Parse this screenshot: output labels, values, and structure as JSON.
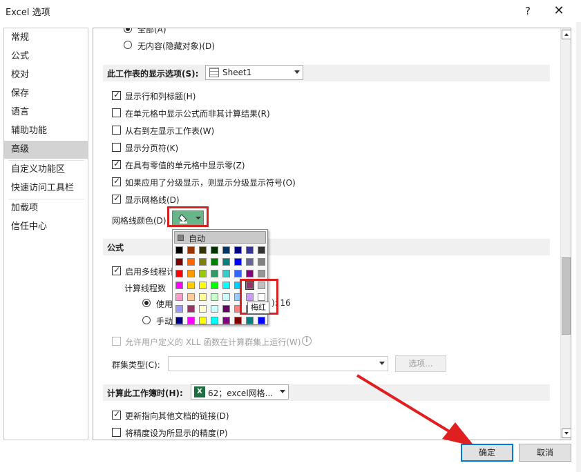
{
  "window": {
    "title": "Excel 选项",
    "help_label": "?",
    "close_label": "✕"
  },
  "sidebar": {
    "items": [
      {
        "label": "常规"
      },
      {
        "label": "公式"
      },
      {
        "label": "校对"
      },
      {
        "label": "保存"
      },
      {
        "label": "语言"
      },
      {
        "label": "辅助功能"
      },
      {
        "label": "高级",
        "active": true
      },
      {
        "label": "自定义功能区"
      },
      {
        "label": "快速访问工具栏"
      },
      {
        "label": "加载项"
      },
      {
        "label": "信任中心"
      }
    ]
  },
  "objects_display": {
    "all_label": "全部(A)",
    "nothing_label": "无内容(隐藏对象)(D)"
  },
  "worksheet_display": {
    "title": "此工作表的显示选项(S):",
    "sheet": "Sheet1",
    "options": [
      {
        "label": "显示行和列标题(H)",
        "checked": true
      },
      {
        "label": "在单元格中显示公式而非其计算结果(R)",
        "checked": false
      },
      {
        "label": "从右到左显示工作表(W)",
        "checked": false
      },
      {
        "label": "显示分页符(K)",
        "checked": false
      },
      {
        "label": "在具有零值的单元格中显示零(Z)",
        "checked": true
      },
      {
        "label": "如果应用了分级显示，则显示分级显示符号(O)",
        "checked": true
      },
      {
        "label": "显示网格线(D)",
        "checked": true
      }
    ],
    "gridline_color_label": "网格线颜色(D)",
    "gridline_color": "#68b58a"
  },
  "palette": {
    "auto_label": "自动",
    "tooltip": "梅红",
    "rows": [
      [
        "#000000",
        "#993300",
        "#333300",
        "#003300",
        "#003366",
        "#000080",
        "#333399",
        "#333333"
      ],
      [
        "#800000",
        "#ff6600",
        "#808000",
        "#008000",
        "#008080",
        "#0000ff",
        "#666699",
        "#808080"
      ],
      [
        "#ff0000",
        "#ff9900",
        "#99cc00",
        "#339966",
        "#33cccc",
        "#3366ff",
        "#800080",
        "#969696"
      ],
      [
        "#ff00ff",
        "#ffcc00",
        "#ffff00",
        "#00ff00",
        "#00ffff",
        "#00ccff",
        "#993366",
        "#c0c0c0"
      ],
      [
        "#ff99cc",
        "#ffcc99",
        "#ffff99",
        "#ccffcc",
        "#ccffff",
        "#99ccff",
        "#cc99ff",
        "#ffffff"
      ],
      [
        "#9999ff",
        "#993366",
        "#ffffcc",
        "#ccffff",
        "#660066",
        "#ff8080",
        "#0066cc",
        "#ccccff"
      ],
      [
        "#000080",
        "#ff00ff",
        "#ffff00",
        "#00ffff",
        "#800080",
        "#800000",
        "#008080",
        "#0000ff"
      ]
    ]
  },
  "formulas": {
    "title": "公式",
    "multithread_label": "启用多线程计",
    "multithread_checked": true,
    "threads_label": "计算线程数",
    "use_label": "使用",
    "manual_label": "手动",
    "threads_suffix": "): 16",
    "xll_label": "允许用户定义的 XLL 函数在计算群集上运行(W)",
    "cluster_label": "群集类型(C):",
    "cluster_value": "",
    "options_button": "选项..."
  },
  "calc_workbook": {
    "title": "计算此工作簿时(H):",
    "workbook": "62；excel网格...",
    "options": [
      {
        "label": "更新指向其他文档的链接(D)",
        "checked": true
      },
      {
        "label": "将精度设为所显示的精度(P)",
        "checked": false
      }
    ]
  },
  "footer": {
    "ok_label": "确定",
    "cancel_label": "取消"
  },
  "colors": {
    "highlight": "#d9201e",
    "accent": "#0078d7"
  }
}
